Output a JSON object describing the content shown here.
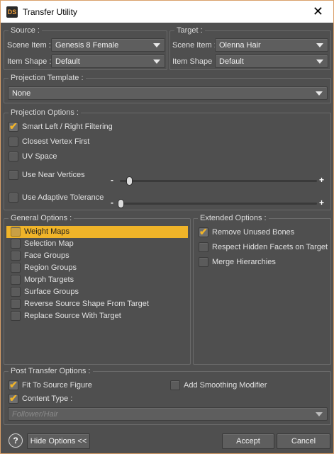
{
  "window": {
    "title": "Transfer Utility",
    "app_icon_text": "DS"
  },
  "source": {
    "group_title": "Source :",
    "scene_item_label": "Scene Item :",
    "scene_item_value": "Genesis 8 Female",
    "item_shape_label": "Item Shape :",
    "item_shape_value": "Default"
  },
  "target": {
    "group_title": "Target :",
    "scene_item_label": "Scene Item :",
    "scene_item_value": "Olenna Hair",
    "item_shape_label": "Item Shape :",
    "item_shape_value": "Default"
  },
  "projection_template": {
    "group_title": "Projection Template :",
    "value": "None"
  },
  "projection_options": {
    "group_title": "Projection Options :",
    "smart_filtering": {
      "label": "Smart Left / Right Filtering",
      "checked": true
    },
    "closest_vertex": {
      "label": "Closest Vertex First",
      "checked": false
    },
    "uv_space": {
      "label": "UV Space",
      "checked": false
    },
    "near_vertices": {
      "label": "Use Near Vertices",
      "checked": false
    },
    "adaptive_tolerance": {
      "label": "Use Adaptive Tolerance",
      "checked": false
    },
    "slider_minus": "-",
    "slider_plus": "+"
  },
  "general_options": {
    "group_title": "General Options :",
    "items": [
      {
        "label": "Weight Maps",
        "checked": false,
        "selected": true
      },
      {
        "label": "Selection Map",
        "checked": false
      },
      {
        "label": "Face Groups",
        "checked": false
      },
      {
        "label": "Region Groups",
        "checked": false
      },
      {
        "label": "Morph Targets",
        "checked": false
      },
      {
        "label": "Surface Groups",
        "checked": false
      },
      {
        "label": "Reverse Source Shape From Target",
        "checked": false
      },
      {
        "label": "Replace Source With Target",
        "checked": false
      }
    ]
  },
  "extended_options": {
    "group_title": "Extended Options :",
    "items": [
      {
        "label": "Remove Unused Bones",
        "checked": true
      },
      {
        "label": "Respect Hidden Facets on Target",
        "checked": false
      },
      {
        "label": "Merge Hierarchies",
        "checked": false
      }
    ]
  },
  "post_transfer": {
    "group_title": "Post Transfer Options :",
    "fit_to_source": {
      "label": "Fit To Source Figure",
      "checked": true
    },
    "add_smoothing": {
      "label": "Add Smoothing Modifier",
      "checked": false
    },
    "content_type": {
      "label": "Content Type :",
      "checked": true,
      "value": "Follower/Hair"
    }
  },
  "footer": {
    "help_label": "?",
    "hide_options_label": "Hide Options <<",
    "accept_label": "Accept",
    "cancel_label": "Cancel"
  },
  "colors": {
    "accent": "#f0b429",
    "background": "#4f4f4f",
    "window_border": "#d9a06a"
  },
  "icons": [
    "app-icon",
    "close-icon",
    "chevron-down-icon",
    "check-icon",
    "help-icon"
  ]
}
